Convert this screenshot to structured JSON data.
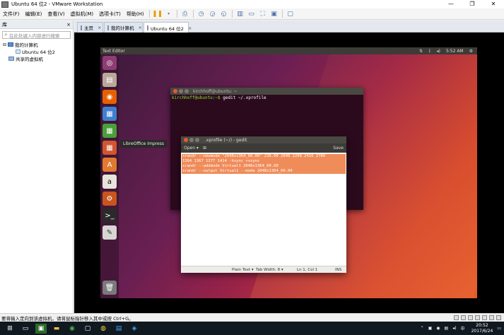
{
  "window": {
    "title": "Ubuntu 64 位2 - VMware Workstation",
    "minimize": "—",
    "maximize": "❐",
    "close": "✕"
  },
  "menu": {
    "items": [
      "文件(F)",
      "编辑(E)",
      "查看(V)",
      "虚拟机(M)",
      "选项卡(T)",
      "帮助(H)"
    ]
  },
  "library": {
    "title": "库",
    "close": "×",
    "search_placeholder": "在此处键入内容进行搜索",
    "tree": {
      "my_computer": "我的计算机",
      "vm": "Ubuntu 64 位2",
      "shared": "共享的虚拟机"
    }
  },
  "tabs": [
    {
      "label": "主页",
      "close": "×"
    },
    {
      "label": "我的计算机",
      "close": "×"
    },
    {
      "label": "Ubuntu 64 位2",
      "close": "×"
    }
  ],
  "guest": {
    "topbar_title": "Text Editor",
    "topbar_time": "5:52 AM",
    "tooltip": "LibreOffice Impress",
    "terminal": {
      "title": "kirchhoff@ubuntu: ~",
      "prompt": "kirchhoff@ubuntu:~$",
      "command": " gedit ~/.xprofile"
    },
    "gedit": {
      "title": ".xprofile (~/) - gedit",
      "open_label": "Open ▾",
      "save_label": "Save",
      "lines": [
        "xrandr --newmode \"2048x1364_60.00\"  236.00  2048 2208 2416 2784",
        "1364 1367 1377 1414 -hsync +vsync",
        "xrandr --addmode Virtual1 2048x1364_60.00",
        "xrandr --output Virtual1 --mode 2048x1364_60.00"
      ],
      "status": {
        "syntax": "Plain Text ▾",
        "tabwidth": "Tab Width: 8 ▾",
        "position": "Ln 1, Col 1",
        "mode": "INS"
      }
    }
  },
  "statusbar": {
    "text": "要将输入定向到该虚拟机，请将鼠标指针移入其中或按 Ctrl+G。"
  },
  "taskbar": {
    "time": "20:52",
    "date": "2017/6/24"
  }
}
